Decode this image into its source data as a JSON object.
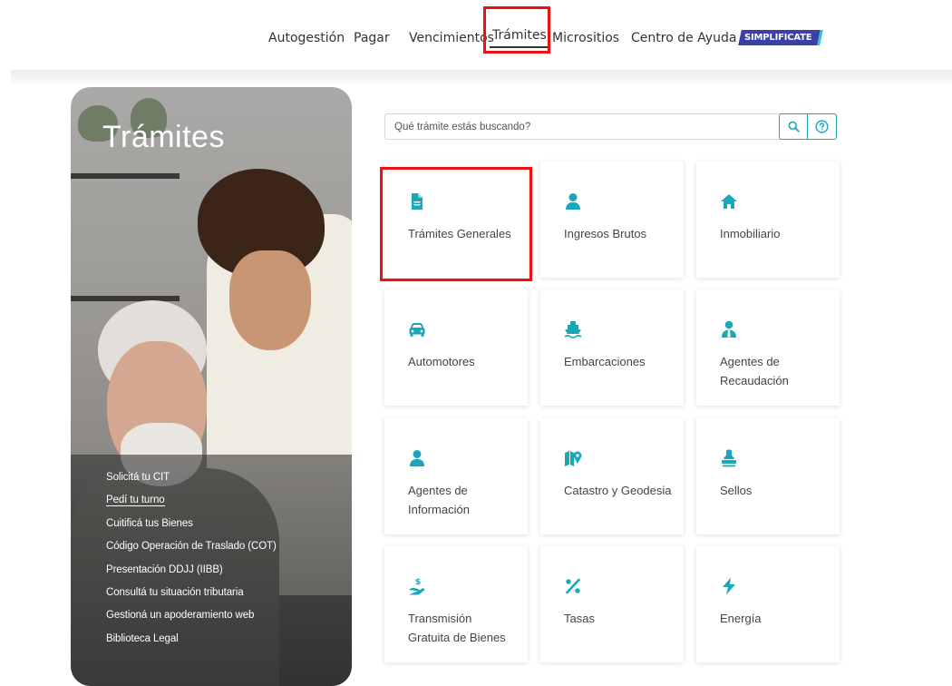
{
  "nav": {
    "items": [
      "Autogestión",
      "Pagar",
      "Vencimientos",
      "Trámites",
      "Micrositios",
      "Centro de Ayuda"
    ],
    "active": "Trámites",
    "brand_badge": "SIMPLIFICATE"
  },
  "hero": {
    "title": "Trámites",
    "links": [
      "Solicitá tu CIT",
      "Pedí tu turno",
      "Cuitificá tus Bienes",
      "Código Operación de Traslado (COT)",
      "Presentación DDJJ (IIBB)",
      "Consultá tu situación tributaria",
      "Gestioná un apoderamiento web",
      "Biblioteca Legal"
    ]
  },
  "search": {
    "placeholder": "Qué trámite estás buscando?",
    "search_icon": "search-icon",
    "help_icon": "help-circle-icon"
  },
  "tiles": [
    {
      "label": "Trámites Generales",
      "icon": "document-icon"
    },
    {
      "label": "Ingresos Brutos",
      "icon": "user-icon"
    },
    {
      "label": "Inmobiliario",
      "icon": "home-icon"
    },
    {
      "label": "Automotores",
      "icon": "car-icon"
    },
    {
      "label": "Embarcaciones",
      "icon": "ship-icon"
    },
    {
      "label": "Agentes de Recaudación",
      "icon": "user-tie-icon"
    },
    {
      "label": "Agentes de Información",
      "icon": "user-icon"
    },
    {
      "label": "Catastro y Geodesia",
      "icon": "map-marker-icon"
    },
    {
      "label": "Sellos",
      "icon": "stamp-icon"
    },
    {
      "label": "Transmisión Gratuita de Bienes",
      "icon": "hand-dollar-icon"
    },
    {
      "label": "Tasas",
      "icon": "percent-icon"
    },
    {
      "label": "Energía",
      "icon": "bolt-icon"
    }
  ],
  "colors": {
    "accent": "#1aa8b8",
    "highlight": "#ee1111",
    "brand": "#3b3fa8"
  }
}
